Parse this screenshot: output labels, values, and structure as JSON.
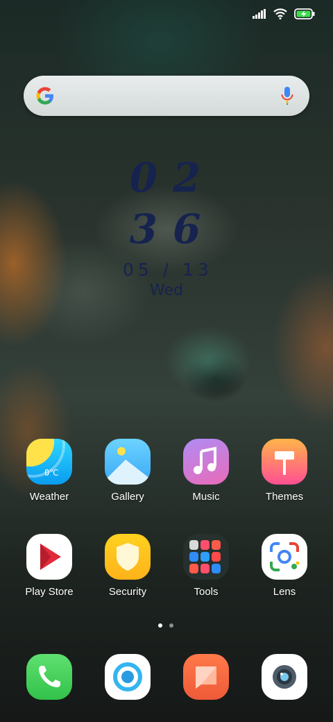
{
  "search": {
    "google_icon": "google-g-icon",
    "mic_icon": "microphone-icon"
  },
  "clock": {
    "hours": "02",
    "minutes": "36",
    "date": "05 / 13",
    "weekday": "Wed"
  },
  "apps_row1": [
    {
      "label": "Weather",
      "icon": "weather-icon",
      "icon_text": "0℃"
    },
    {
      "label": "Gallery",
      "icon": "gallery-icon"
    },
    {
      "label": "Music",
      "icon": "music-icon"
    },
    {
      "label": "Themes",
      "icon": "themes-icon"
    }
  ],
  "apps_row2": [
    {
      "label": "Play Store",
      "icon": "play-store-icon"
    },
    {
      "label": "Security",
      "icon": "security-icon"
    },
    {
      "label": "Tools",
      "icon": "tools-folder-icon"
    },
    {
      "label": "Lens",
      "icon": "lens-icon"
    }
  ],
  "dock": [
    {
      "name": "phone",
      "icon": "phone-icon"
    },
    {
      "name": "browser",
      "icon": "browser-icon"
    },
    {
      "name": "messages",
      "icon": "messages-icon"
    },
    {
      "name": "camera",
      "icon": "camera-icon"
    }
  ],
  "pager": {
    "pages": 2,
    "current": 1
  },
  "colors": {
    "clock": "#16234f",
    "accent": "#ffffff"
  }
}
